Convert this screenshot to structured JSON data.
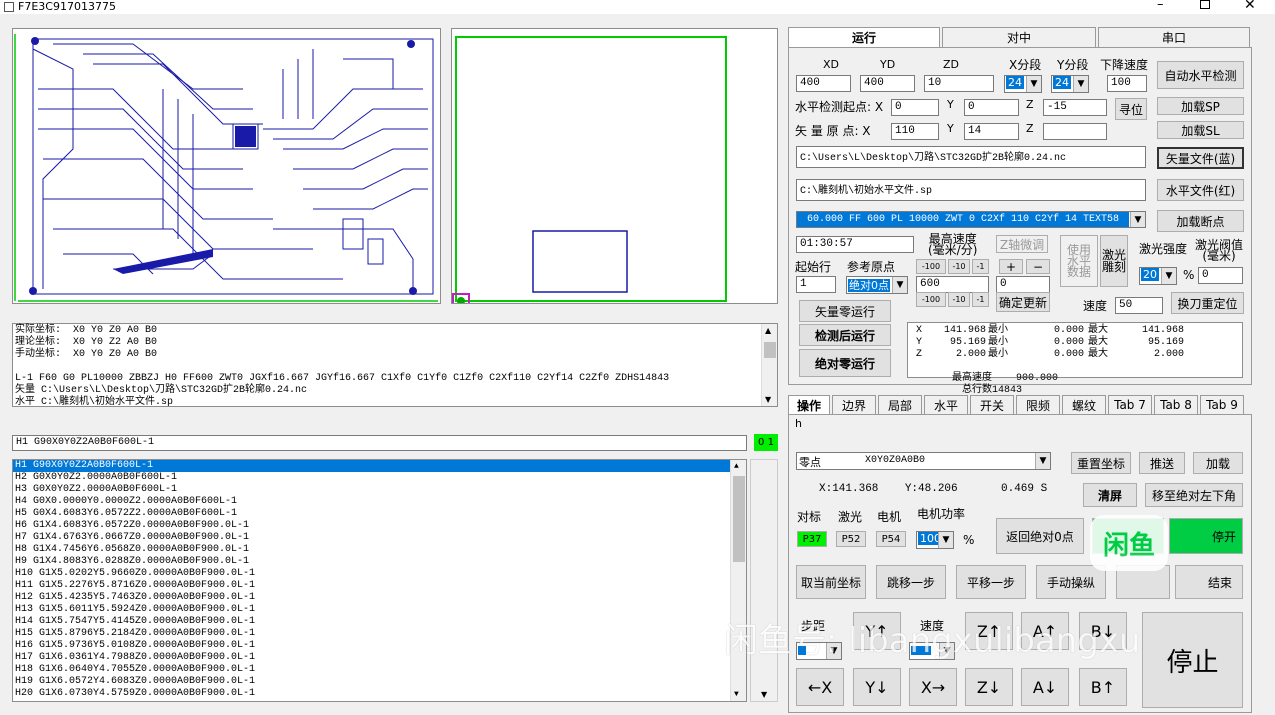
{
  "window": {
    "title": "F7E3C917013775"
  },
  "preview": {},
  "info_log": {
    "lines": [
      "实际坐标:  X0 Y0 Z0 A0 B0",
      "理论坐标:  X0 Y0 Z2 A0 B0",
      "手动坐标:  X0 Y0 Z0 A0 B0",
      "",
      "L-1 F60 G0 PL10000 ZBBZJ H0 FF600 ZWT0 JGXf16.667 JGYf16.667 C1Xf0 C1Yf0 C1Zf0 C2Xf110 C2Yf14 C2Zf0 ZDHS14843",
      "矢量 C:\\Users\\L\\Desktop\\刀路\\STC32GD扩2B轮廓0.24.nc",
      "水平 C:\\雕刻机\\初始水平文件.sp"
    ]
  },
  "command": {
    "value": "H1 G90X0Y0Z2A0B0F600L-1",
    "indicator": "0 1"
  },
  "gcode_list": [
    "H1 G90X0Y0Z2A0B0F600L-1",
    "H2 G0X0Y0Z2.0000A0B0F600L-1",
    "H3 G0X0Y0Z2.0000A0B0F600L-1",
    "H4 G0X0.0000Y0.0000Z2.0000A0B0F600L-1",
    "H5 G0X4.6083Y6.0572Z2.0000A0B0F600L-1",
    "H6 G1X4.6083Y6.0572Z0.0000A0B0F900.0L-1",
    "H7 G1X4.6763Y6.0667Z0.0000A0B0F900.0L-1",
    "H8 G1X4.7456Y6.0568Z0.0000A0B0F900.0L-1",
    "H9 G1X4.8083Y6.0288Z0.0000A0B0F900.0L-1",
    "H10 G1X5.0202Y5.9660Z0.0000A0B0F900.0L-1",
    "H11 G1X5.2276Y5.8716Z0.0000A0B0F900.0L-1",
    "H12 G1X5.4235Y5.7463Z0.0000A0B0F900.0L-1",
    "H13 G1X5.6011Y5.5924Z0.0000A0B0F900.0L-1",
    "H14 G1X5.7547Y5.4145Z0.0000A0B0F900.0L-1",
    "H15 G1X5.8796Y5.2184Z0.0000A0B0F900.0L-1",
    "H16 G1X5.9736Y5.0108Z0.0000A0B0F900.0L-1",
    "H17 G1X6.0361Y4.7988Z0.0000A0B0F900.0L-1",
    "H18 G1X6.0640Y4.7055Z0.0000A0B0F900.0L-1",
    "H19 G1X6.0572Y4.6083Z0.0000A0B0F900.0L-1",
    "H20 G1X6.0730Y4.5759Z0.0000A0B0F900.0L-1"
  ],
  "top_tabs": [
    "运行",
    "对中",
    "串口"
  ],
  "run": {
    "col_labels": {
      "xd": "XD",
      "yd": "YD",
      "zd": "ZD",
      "xseg": "X分段",
      "yseg": "Y分段",
      "down_speed": "下降速度"
    },
    "xd": "400",
    "yd": "400",
    "zd": "10",
    "xseg": "24",
    "yseg": "24",
    "down_speed": "100",
    "auto_level_btn": "自动水平检测",
    "level_start_label": "水平检测起点: X",
    "vector_origin_label": "矢 量  原 点: X",
    "y_label": "Y",
    "z_label": "Z",
    "level_x": "0",
    "level_y": "0",
    "level_z": "-15",
    "origin_x": "110",
    "origin_y": "14",
    "origin_z": "",
    "seek_btn": "寻位",
    "load_sp_btn": "加载SP",
    "load_sl_btn": "加载SL",
    "vector_path": "C:\\Users\\L\\Desktop\\刀路\\STC32GD扩2B轮廓0.24.nc",
    "vector_file_btn": "矢量文件(蓝)",
    "level_path": "C:\\雕刻机\\初始水平文件.sp",
    "level_file_btn": "水平文件(红)",
    "params": "60.000 FF 600 PL 10000 ZWT 0 C2Xf 110 C2Yf 14 TEXT58",
    "load_breakpoint_btn": "加载断点",
    "time": "01:30:57",
    "max_speed_label": "最高速度\n(毫米/分)",
    "z_micro_label": "Z轴微调",
    "use_level_btn": "使用\n水平\n数据",
    "laser_engrave_btn": "激光\n雕刻",
    "laser_power_label": "激光强度",
    "laser_threshold_label": "激光阀值\n(毫米)",
    "start_row_label": "起始行",
    "start_row": "1",
    "ref_origin_label": "参考原点",
    "ref_origin": "绝对0点",
    "max_speed": "600",
    "z_micro": "0",
    "laser_power": "20",
    "percent": "%",
    "laser_threshold": "0",
    "minus100": "-100",
    "minus10": "-10",
    "minus1": "-1",
    "plus": "+",
    "minus": "−",
    "confirm_update_btn": "确定更新",
    "speed_label": "速度",
    "speed": "50",
    "tool_change_btn": "换刀重定位",
    "vector_zero_run_btn": "矢量零运行",
    "check_run_btn": "检测后运行",
    "abs_zero_run_btn": "绝对零运行",
    "stats": [
      {
        "axis": "X",
        "value": "141.968",
        "min_label": "最小",
        "min": "0.000",
        "max_label": "最大",
        "max": "141.968"
      },
      {
        "axis": "Y",
        "value": "95.169",
        "min_label": "最小",
        "min": "0.000",
        "max_label": "最大",
        "max": "95.169"
      },
      {
        "axis": "Z",
        "value": "2.000",
        "min_label": "最小",
        "min": "0.000",
        "max_label": "最大",
        "max": "2.000"
      }
    ],
    "max_speed_stat": "最高速度    900.000",
    "total_rows": "总行数14843"
  },
  "bottom_tabs": [
    "操作",
    "边界",
    "局部",
    "水平",
    "开关",
    "限频",
    "螺纹",
    "Tab 7",
    "Tab 8",
    "Tab 9"
  ],
  "op": {
    "h_text": "h",
    "zero_point": "零点",
    "zero_value": "X0Y0Z0A0B0",
    "reset_coord_btn": "重置坐标",
    "push_btn": "推送",
    "load_btn": "加载",
    "coord_readout": "X:141.368    Y:48.206",
    "time_readout": "0.469 S",
    "clear_btn": "清屏",
    "move_abs_down_btn": "移至绝对左下角",
    "align_label": "对标",
    "laser_label": "激光",
    "motor_label": "电机",
    "motor_power_label": "电机功率",
    "p37": "P37",
    "p52": "P52",
    "p54": "P54",
    "motor_power": "100",
    "percent": "%",
    "return_abs_zero_btn": "返回绝对0点",
    "right_partial_btn": "停开",
    "get_coord_btn": "取当前坐标",
    "jump_step_btn": "跳移一步",
    "pan_step_btn": "平移一步",
    "manual_btn": "手动操纵",
    "end_btn": "结束",
    "step_label": "步距",
    "speed_label": "速度",
    "y_up": "Y↑",
    "z_up": "Z↑",
    "a_up": "A↑",
    "b_down": "B↓",
    "x_left": "←X",
    "y_down": "Y↓",
    "x_right": "X→",
    "z_down": "Z↓",
    "a_down": "A↓",
    "b_up": "B↑",
    "stop_btn": "停止"
  },
  "watermark": {
    "text": "闲鱼号: libangxulibangxu",
    "logo": "闲鱼"
  }
}
